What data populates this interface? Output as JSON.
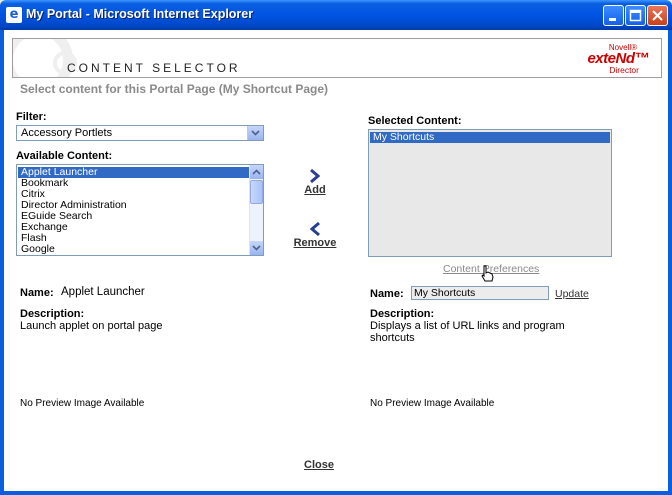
{
  "window": {
    "title": "My Portal - Microsoft Internet Explorer"
  },
  "banner": {
    "heading": "CONTENT SELECTOR",
    "logo_novell": "Novell®",
    "logo_extend": "exteNd™",
    "logo_director": "Director"
  },
  "page": {
    "subtitle": "Select content for this Portal Page (My Shortcut Page)"
  },
  "filter": {
    "label": "Filter:",
    "selected": "Accessory Portlets"
  },
  "available": {
    "label": "Available Content:",
    "items": [
      "Applet Launcher",
      "Bookmark",
      "Citrix",
      "Director Administration",
      "EGuide Search",
      "Exchange",
      "Flash",
      "Google"
    ]
  },
  "actions": {
    "add_label": "Add",
    "remove_label": "Remove"
  },
  "selected": {
    "label": "Selected Content:",
    "items": [
      "My Shortcuts"
    ],
    "preferences_link": "Content Preferences"
  },
  "left_details": {
    "name_label": "Name:",
    "name_value": "Applet Launcher",
    "description_label": "Description:",
    "description_value": "Launch applet on portal page",
    "preview_text": "No Preview Image Available"
  },
  "right_details": {
    "name_label": "Name:",
    "name_value": "My Shortcuts",
    "update_link": "Update",
    "description_label": "Description:",
    "description_value": "Displays a list of URL links and program shortcuts",
    "preview_text": "No Preview Image Available"
  },
  "footer": {
    "close_link": "Close"
  }
}
